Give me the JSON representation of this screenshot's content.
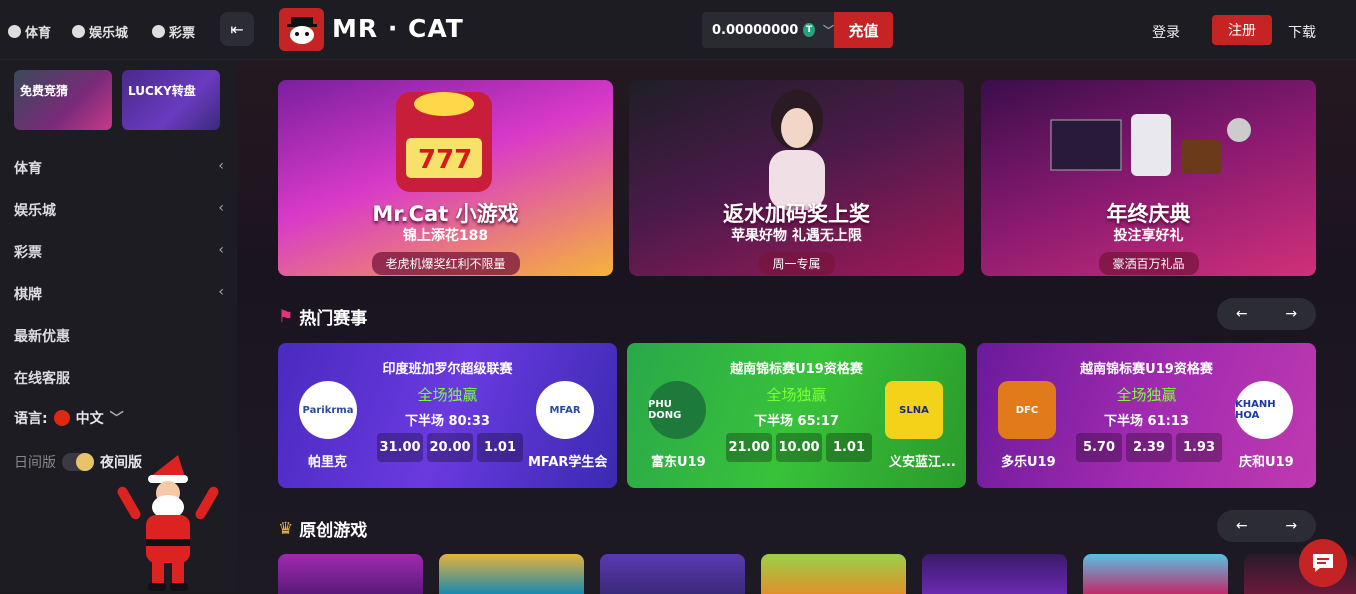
{
  "topbar": {
    "tabs": [
      {
        "label": "体育",
        "icon": "sports-icon"
      },
      {
        "label": "娱乐城",
        "icon": "casino-icon"
      },
      {
        "label": "彩票",
        "icon": "lottery-icon"
      }
    ],
    "brand": "MR · CAT",
    "balance": "0.00000000",
    "currency_icon": "T",
    "deposit": "充值",
    "login": "登录",
    "register": "注册",
    "download": "下载"
  },
  "sidebar": {
    "promos": [
      {
        "label": "免费竞猜"
      },
      {
        "label": "LUCKY转盘"
      }
    ],
    "nav": [
      {
        "label": "体育"
      },
      {
        "label": "娱乐城"
      },
      {
        "label": "彩票"
      },
      {
        "label": "棋牌"
      },
      {
        "label": "最新优惠"
      },
      {
        "label": "在线客服"
      }
    ],
    "language_label": "语言:",
    "language": "中文",
    "day_mode": "日间版",
    "night_mode": "夜间版"
  },
  "banners": [
    {
      "title": "Mr.Cat 小游戏",
      "subtitle": "锦上添花188",
      "pill": "老虎机爆奖红利不限量"
    },
    {
      "title": "返水加码奖上奖",
      "subtitle": "苹果好物  礼遇无上限",
      "pill": "周一专属"
    },
    {
      "title": "年终庆典",
      "subtitle": "投注享好礼",
      "pill": "豪洒百万礼品"
    }
  ],
  "hot_events": {
    "title": "热门赛事",
    "matches": [
      {
        "league": "印度班加罗尔超级联赛",
        "status": "全场独赢",
        "time": "下半场 80:33",
        "odds": [
          "31.00",
          "20.00",
          "1.01"
        ],
        "home": "帕里克",
        "away": "MFAR学生会"
      },
      {
        "league": "越南锦标赛U19资格赛",
        "status": "全场独赢",
        "time": "下半场 65:17",
        "odds": [
          "21.00",
          "10.00",
          "1.01"
        ],
        "home": "富东U19",
        "away": "义安蓝江..."
      },
      {
        "league": "越南锦标赛U19资格赛",
        "status": "全场独赢",
        "time": "下半场 61:13",
        "odds": [
          "5.70",
          "2.39",
          "1.93"
        ],
        "home": "多乐U19",
        "away": "庆和U19"
      }
    ]
  },
  "original_games": {
    "title": "原创游戏"
  },
  "colors": {
    "accent": "#c62424",
    "win_green": "#7cff3a"
  }
}
